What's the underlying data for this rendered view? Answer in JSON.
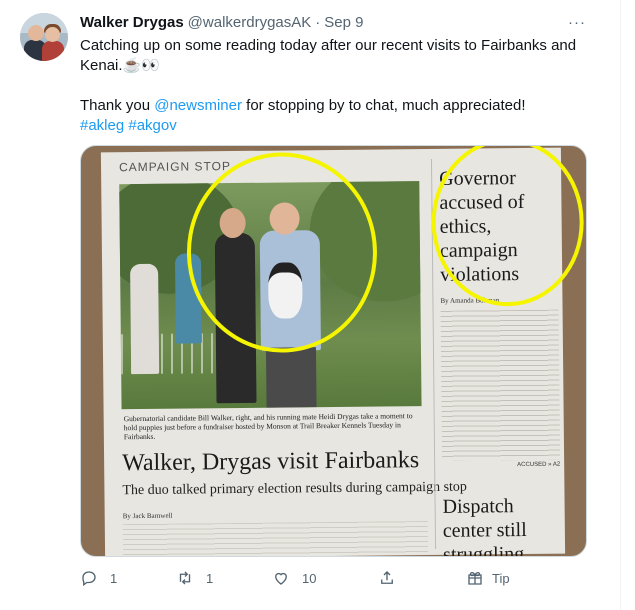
{
  "author": {
    "name": "Walker Drygas",
    "handle": "@walkerdrygasAK",
    "separator": "·",
    "date": "Sep 9"
  },
  "more_label": "···",
  "tweet": {
    "line1": "Catching up on some reading today after our recent visits to Fairbanks and",
    "line2": "Kenai.",
    "emoji": "☕👀",
    "thanks_before": "Thank you ",
    "mention": "@newsminer",
    "thanks_after": " for stopping by to chat, much appreciated!",
    "hashtag1": "#akleg",
    "hashtag2": "#akgov"
  },
  "newspaper": {
    "kicker": "CAMPAIGN STOP",
    "caption": "Gubernatorial candidate Bill Walker, right, and his running mate Heidi Drygas take a moment to hold puppies just before a fundraiser hosted by Monson at Trail Breaker Kennels Tuesday in Fairbanks.",
    "headline": "Walker, Drygas visit Fairbanks",
    "deck": "The duo talked primary election results during campaign stop",
    "byline": "By Jack Barnwell",
    "side_headline": "Governor accused of ethics, campaign violations",
    "side_byline": "By Amanda Bohman",
    "side_jump": "ACCUSED » A2",
    "side_headline2": "Dispatch center still struggling"
  },
  "actions": {
    "replies": "1",
    "retweets": "1",
    "likes": "10",
    "tip": "Tip"
  },
  "colors": {
    "link": "#1d9bf0",
    "muted": "#536471",
    "highlight_circle": "#f5f500"
  }
}
